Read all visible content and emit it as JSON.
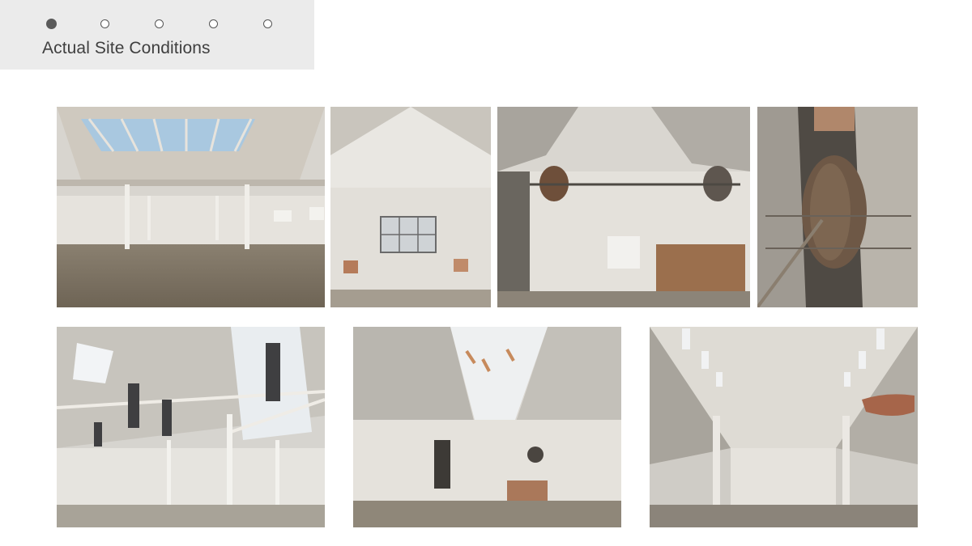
{
  "header": {
    "title": "Actual Site Conditions",
    "pager": {
      "total": 5,
      "current": 1,
      "dots": [
        {
          "label": "slide-1",
          "active": true
        },
        {
          "label": "slide-2",
          "active": false
        },
        {
          "label": "slide-3",
          "active": false
        },
        {
          "label": "slide-4",
          "active": false
        },
        {
          "label": "slide-5",
          "active": false
        }
      ]
    }
  },
  "gallery": {
    "photos": [
      {
        "subject": "warehouse hall with skylight roof trusses"
      },
      {
        "subject": "gable wall with window"
      },
      {
        "subject": "wall with ventilation fans and doorway"
      },
      {
        "subject": "narrow shaft with large wheel"
      },
      {
        "subject": "hall with ducts and skylights"
      },
      {
        "subject": "hall with central skylight and fans"
      },
      {
        "subject": "long hall with columns and clerestory windows"
      }
    ]
  },
  "colors": {
    "panel_bg": "#ebebeb",
    "text": "#3f3f3f",
    "dot": "#5a5a5a"
  }
}
